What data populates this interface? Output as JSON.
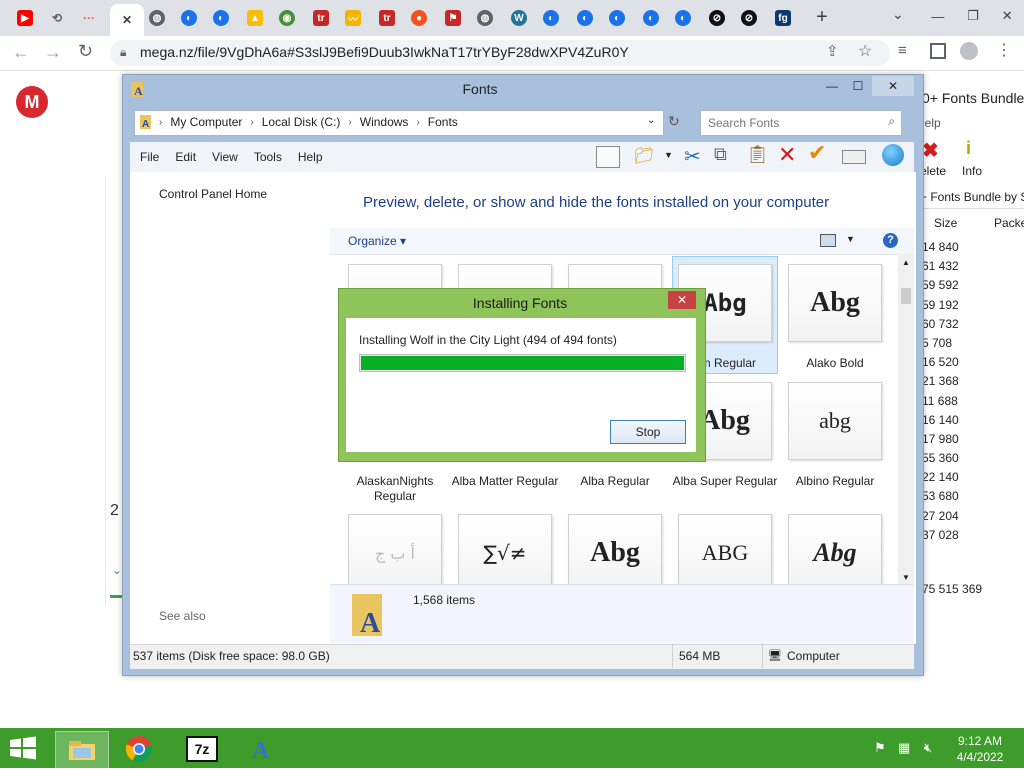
{
  "browser": {
    "url": "mega.nz/file/9VgDhA6a#S3slJ9Befi9Duub3IwkNaT17trYByF28dwXPV4ZuR0Y",
    "new_tab_label": "+",
    "tabs_menu_label": "⌄"
  },
  "tab_favicons": [
    {
      "icon": "youtube-icon",
      "color": "#ff0000",
      "glyph": "▶"
    },
    {
      "icon": "history-icon",
      "color": "#5f6368",
      "glyph": "⟲"
    },
    {
      "icon": "dots-icon",
      "color": "#e05a5a",
      "glyph": "···"
    },
    {
      "icon": "close-icon",
      "color": "#3c4043",
      "glyph": "✕"
    },
    {
      "icon": "globe-icon",
      "color": "#5f6368",
      "glyph": "◍"
    },
    {
      "icon": "edge-icon",
      "color": "#1a73e8",
      "glyph": "◐"
    },
    {
      "icon": "edge-icon",
      "color": "#1a73e8",
      "glyph": "◐"
    },
    {
      "icon": "drive-icon",
      "color": "#fbbc04",
      "glyph": "▲"
    },
    {
      "icon": "earth-icon",
      "color": "#4a8f3c",
      "glyph": "◉"
    },
    {
      "icon": "tr-icon",
      "color": "#c62828",
      "glyph": "tr"
    },
    {
      "icon": "mustache-icon",
      "color": "#f5b400",
      "glyph": "〰"
    },
    {
      "icon": "tr-icon",
      "color": "#c62828",
      "glyph": "tr"
    },
    {
      "icon": "ball-icon",
      "color": "#f4511e",
      "glyph": "●"
    },
    {
      "icon": "flag-icon",
      "color": "#c62828",
      "glyph": "⚑"
    },
    {
      "icon": "globe-icon",
      "color": "#5f6368",
      "glyph": "◍"
    },
    {
      "icon": "wordpress-icon",
      "color": "#21759b",
      "glyph": "W"
    },
    {
      "icon": "edge-icon",
      "color": "#1a73e8",
      "glyph": "◐"
    },
    {
      "icon": "edge-icon",
      "color": "#1a73e8",
      "glyph": "◐"
    },
    {
      "icon": "edge-icon",
      "color": "#1a73e8",
      "glyph": "◐"
    },
    {
      "icon": "edge-icon",
      "color": "#1a73e8",
      "glyph": "◐"
    },
    {
      "icon": "edge-icon",
      "color": "#1a73e8",
      "glyph": "◐"
    },
    {
      "icon": "black-circle-icon",
      "color": "#111111",
      "glyph": "⊘"
    },
    {
      "icon": "black-circle-icon",
      "color": "#111111",
      "glyph": "⊘"
    },
    {
      "icon": "fg-icon",
      "color": "#0b3a6e",
      "glyph": "fg"
    }
  ],
  "explorer": {
    "title": "Fonts",
    "breadcrumb": [
      "My Computer",
      "Local Disk (C:)",
      "Windows",
      "Fonts"
    ],
    "search_placeholder": "Search Fonts",
    "menu": [
      "File",
      "Edit",
      "View",
      "Tools",
      "Help"
    ],
    "nav": {
      "home": "Control Panel Home",
      "see_also": "See also"
    },
    "heading": "Preview, delete, or show and hide the fonts installed on your computer",
    "organize": "Organize",
    "items_count": "1,568 items",
    "status": {
      "left": "537 items (Disk free space: 98.0 GB)",
      "size": "564 MB",
      "location": "Computer"
    },
    "fonts_row1": [
      {
        "name": "",
        "sample": ""
      },
      {
        "name": "",
        "sample": ""
      },
      {
        "name": "",
        "sample": ""
      },
      {
        "name": "om Regular",
        "sample": "Abg"
      },
      {
        "name": "Alako Bold",
        "sample": "Abg"
      }
    ],
    "fonts_row2": [
      {
        "name": "AlaskanNights Regular",
        "sample": ""
      },
      {
        "name": "Alba Matter Regular",
        "sample": ""
      },
      {
        "name": "Alba Regular",
        "sample": ""
      },
      {
        "name": "Alba Super Regular",
        "sample": "Abg"
      },
      {
        "name": "Albino Regular",
        "sample": "abg"
      }
    ],
    "fonts_row3": [
      {
        "name": "",
        "sample": "أ ب ج"
      },
      {
        "name": "",
        "sample": "∑√≠"
      },
      {
        "name": "",
        "sample": "Abg"
      },
      {
        "name": "",
        "sample": "ABG"
      },
      {
        "name": "",
        "sample": "Abg"
      }
    ]
  },
  "dialog": {
    "title": "Installing Fonts",
    "message": "Installing Wolf in the City Light (494 of 494 fonts)",
    "progress_fraction": 1.0,
    "stop_label": "Stop"
  },
  "zip_window": {
    "title": "0+ Fonts Bundle",
    "menu": "lelp",
    "delete_label": "elete",
    "info_label": "Info",
    "path": "+ Fonts Bundle by S",
    "col_size": "Size",
    "col_packed": "Packe",
    "sizes": [
      "14 840",
      "61 432",
      "59 592",
      "59 192",
      "60 732",
      "5 708",
      "16 520",
      "21 368",
      "11 688",
      "16 140",
      "17 980",
      "55 360",
      "22 140",
      "53 680",
      "27 204",
      "37 028"
    ],
    "total": "75 515 369"
  },
  "mega": {
    "logo": "M",
    "left_digit": "2"
  },
  "taskbar": {
    "time": "9:12 AM",
    "date": "4/4/2022"
  }
}
